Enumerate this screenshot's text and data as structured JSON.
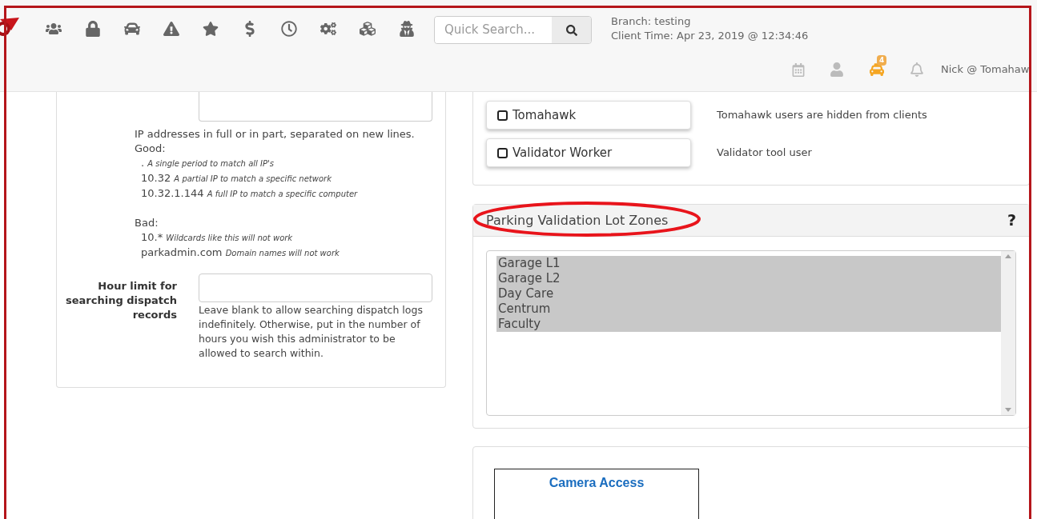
{
  "header": {
    "search": {
      "placeholder": "Quick Search..."
    },
    "branch": "Branch: testing",
    "client_time": "Client Time: Apr 23, 2019 @ 12:34:46",
    "dispatch_badge": "4",
    "user": "Nick @ Tomahaw"
  },
  "ip_help": {
    "intro": "IP addresses in full or in part, separated on new lines.",
    "good_label": "Good:",
    "good": [
      {
        "value": ".",
        "note": "A single period to match all IP's"
      },
      {
        "value": "10.32",
        "note": "A partial IP to match a specific network"
      },
      {
        "value": "10.32.1.144",
        "note": "A full IP to match a specific computer"
      }
    ],
    "bad_label": "Bad:",
    "bad": [
      {
        "value": "10.*",
        "note": "Wildcards like this will not work"
      },
      {
        "value": "parkadmin.com",
        "note": "Domain names will not work"
      }
    ]
  },
  "hour_limit": {
    "label": "Hour limit for searching dispatch records",
    "help": "Leave blank to allow searching dispatch logs indefinitely. Otherwise, put in the number of hours you wish this administrator to be allowed to search within."
  },
  "roles": [
    {
      "label": "Tomahawk",
      "checked": false,
      "description": "Tomahawk users are hidden from clients"
    },
    {
      "label": "Validator Worker",
      "checked": false,
      "description": "Validator tool user"
    }
  ],
  "zones_panel": {
    "title": "Parking Validation Lot Zones",
    "help": "?",
    "options": [
      {
        "label": "Garage L1",
        "selected": true
      },
      {
        "label": "Garage L2",
        "selected": true
      },
      {
        "label": "Day Care",
        "selected": true
      },
      {
        "label": "Centrum",
        "selected": true
      },
      {
        "label": "Faculty",
        "selected": true
      }
    ]
  },
  "camera": {
    "title": "Camera Access"
  }
}
